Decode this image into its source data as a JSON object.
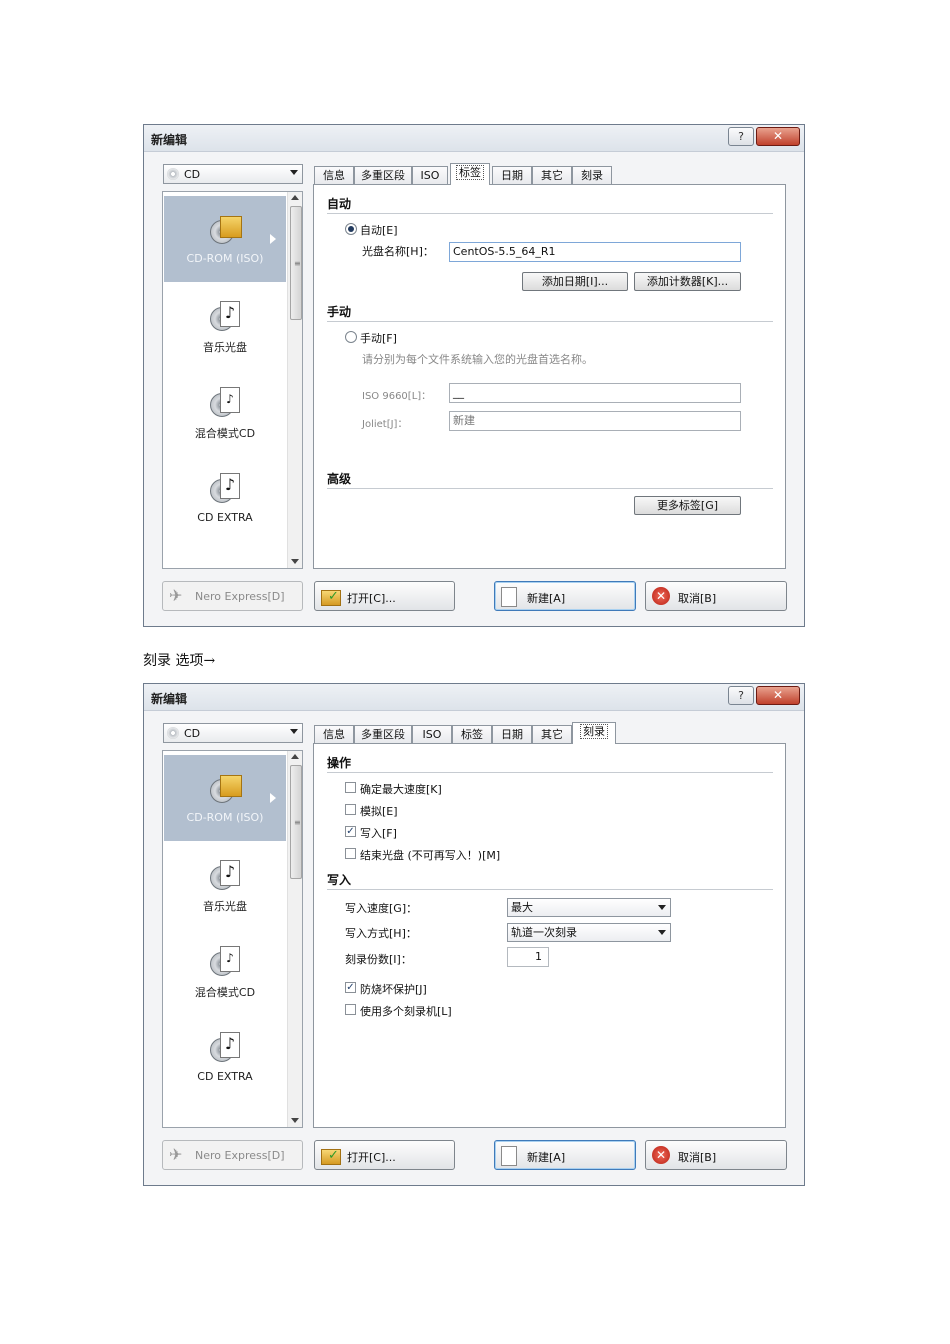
{
  "dialog": {
    "title": "新编辑",
    "help_label": "?",
    "close_label": "✕",
    "disc_type": "CD",
    "tabs": [
      "信息",
      "多重区段",
      "ISO",
      "标签",
      "日期",
      "其它",
      "刻录"
    ],
    "compilation_types": [
      "CD-ROM (ISO)",
      "音乐光盘",
      "混合模式CD",
      "CD EXTRA"
    ],
    "buttons": {
      "nero_express": "Nero Express[D]",
      "open": "打开[C]...",
      "new": "新建[A]",
      "cancel": "取消[B]"
    }
  },
  "label_tab": {
    "auto_section": "自动",
    "auto_radio": "自动[E]",
    "disc_name_label": "光盘名称[H]：",
    "disc_name_value": "CentOS-5.5_64_R1",
    "add_date_button": "添加日期[I]...",
    "add_counter_button": "添加计数器[K]...",
    "manual_section": "手动",
    "manual_radio": "手动[F]",
    "manual_hint": "请分别为每个文件系统输入您的光盘首选名称。",
    "iso9660_label": "ISO 9660[L]：",
    "iso9660_value": "__",
    "joliet_label": "Joliet[J]：",
    "joliet_value": "新建",
    "advanced_section": "高级",
    "more_labels_button": "更多标签[G]"
  },
  "caption": "刻录 选项→",
  "burn_tab": {
    "action_section": "操作",
    "checks": [
      {
        "label": "确定最大速度[K]",
        "checked": false
      },
      {
        "label": "模拟[E]",
        "checked": false
      },
      {
        "label": "写入[F]",
        "checked": true
      },
      {
        "label": "结束光盘 (不可再写入！)[M]",
        "checked": false
      }
    ],
    "write_section": "写入",
    "speed_label": "写入速度[G]：",
    "speed_value": "最大",
    "method_label": "写入方式[H]：",
    "method_value": "轨道一次刻录",
    "copies_label": "刻录份数[I]：",
    "copies_value": "1",
    "burnproof_label": "防烧坏保护[J]",
    "burnproof_checked": true,
    "multi_recorder_label": "使用多个刻录机[L]",
    "multi_recorder_checked": false
  }
}
